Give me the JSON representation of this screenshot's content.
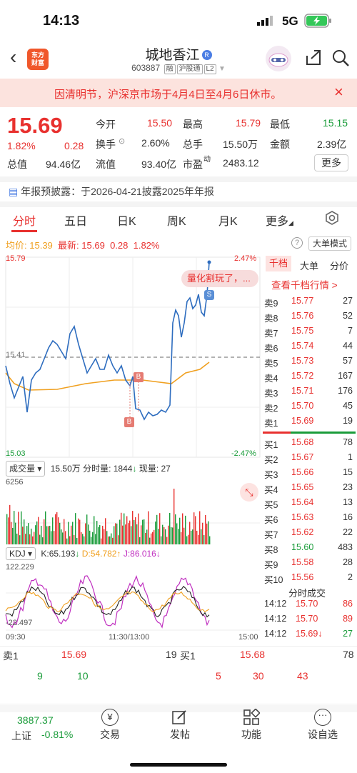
{
  "status": {
    "time": "14:13",
    "network": "5G"
  },
  "app_logo": "东方\n财富",
  "stock": {
    "name": "城地香江",
    "rz_badge": "R",
    "code": "603887",
    "tags": [
      "融",
      "沪股通",
      "L2"
    ]
  },
  "notice": {
    "text": "因清明节，沪深京市场于4月4日至4月6日休市。"
  },
  "quote": {
    "price": "15.69",
    "change_pct": "1.82%",
    "change": "0.28",
    "open_label": "今开",
    "open": "15.50",
    "high_label": "最高",
    "high": "15.79",
    "low_label": "最低",
    "low": "15.15",
    "turnover_label": "换手",
    "turnover": "2.60%",
    "vol_label": "总手",
    "vol": "15.50万",
    "amount_label": "金额",
    "amount": "2.39亿",
    "mcap_label": "总值",
    "mcap": "94.46亿",
    "float_label": "流值",
    "float": "93.40亿",
    "pe_label": "市盈",
    "pe_sup": "动",
    "pe": "2483.12",
    "more_label": "更多"
  },
  "announcement": "年报预披露：于2026-04-21披露2025年年报",
  "tabs": [
    "分时",
    "五日",
    "日K",
    "周K",
    "月K",
    "更多"
  ],
  "chart_header": {
    "avg_label": "均价:",
    "avg": "15.39",
    "latest_label": "最新:",
    "latest": "15.69",
    "chg": "0.28",
    "pct": "1.82%",
    "mode_label": "大单模式"
  },
  "axis": {
    "top": "15.79",
    "mid": "15.41",
    "bottom": "15.03",
    "top_pct": "2.47%",
    "bottom_pct": "-2.47%",
    "vol_max": "6256",
    "kdj_max": "122.229",
    "kdj_min": "-22.497",
    "t_start": "09:30",
    "t_mid": "11:30/13:00",
    "t_end": "15:00"
  },
  "bubble": "量化割玩了，...",
  "marks": {
    "b": "B",
    "s": "S"
  },
  "vol_bar": {
    "sel": "成交量",
    "text1": "15.50万",
    "text2": "分时量: 1844",
    "text3": "现量: 27"
  },
  "kdj_bar": {
    "sel": "KDJ",
    "k": "K:65.193",
    "d": "D:54.782",
    "j": "J:86.016"
  },
  "panel": {
    "tabs": [
      "千档",
      "大单",
      "分价"
    ],
    "link": "查看千档行情 >",
    "asks": [
      {
        "l": "卖9",
        "p": "15.77",
        "v": "27"
      },
      {
        "l": "卖8",
        "p": "15.76",
        "v": "52"
      },
      {
        "l": "卖7",
        "p": "15.75",
        "v": "7"
      },
      {
        "l": "卖6",
        "p": "15.74",
        "v": "44"
      },
      {
        "l": "卖5",
        "p": "15.73",
        "v": "57"
      },
      {
        "l": "卖4",
        "p": "15.72",
        "v": "167"
      },
      {
        "l": "卖3",
        "p": "15.71",
        "v": "176"
      },
      {
        "l": "卖2",
        "p": "15.70",
        "v": "45"
      },
      {
        "l": "卖1",
        "p": "15.69",
        "v": "19"
      }
    ],
    "bids": [
      {
        "l": "买1",
        "p": "15.68",
        "v": "78"
      },
      {
        "l": "买2",
        "p": "15.67",
        "v": "1"
      },
      {
        "l": "买3",
        "p": "15.66",
        "v": "15"
      },
      {
        "l": "买4",
        "p": "15.65",
        "v": "23"
      },
      {
        "l": "买5",
        "p": "15.64",
        "v": "13"
      },
      {
        "l": "买6",
        "p": "15.63",
        "v": "16"
      },
      {
        "l": "买7",
        "p": "15.62",
        "v": "22"
      },
      {
        "l": "买8",
        "p": "15.60",
        "v": "483"
      },
      {
        "l": "买9",
        "p": "15.58",
        "v": "28"
      },
      {
        "l": "买10",
        "p": "15.56",
        "v": "2"
      }
    ],
    "trades_title": "分时成交",
    "trades": [
      {
        "t": "14:12",
        "p": "15.70",
        "v": "86"
      },
      {
        "t": "14:12",
        "p": "15.70",
        "v": "89"
      },
      {
        "t": "14:12",
        "p": "15.69↓",
        "v": "27"
      }
    ]
  },
  "bottom_quote": {
    "ask_label": "卖1",
    "ask_price": "15.69",
    "ask_vol": "19",
    "bid_label": "买1",
    "bid_price": "15.68",
    "bid_vol": "78",
    "n1": "9",
    "n2": "10",
    "n3": "5",
    "n4": "30",
    "n5": "43"
  },
  "bottom_nav": {
    "index_value": "3887.37",
    "index_name": "上证",
    "index_pct": "-0.81%",
    "items": [
      "交易",
      "发帖",
      "功能",
      "设自选"
    ]
  },
  "colors": {
    "up": "#e8312f",
    "down": "#1a9c3a",
    "price_line": "#2e6dbf",
    "avg_line": "#f0a020"
  }
}
